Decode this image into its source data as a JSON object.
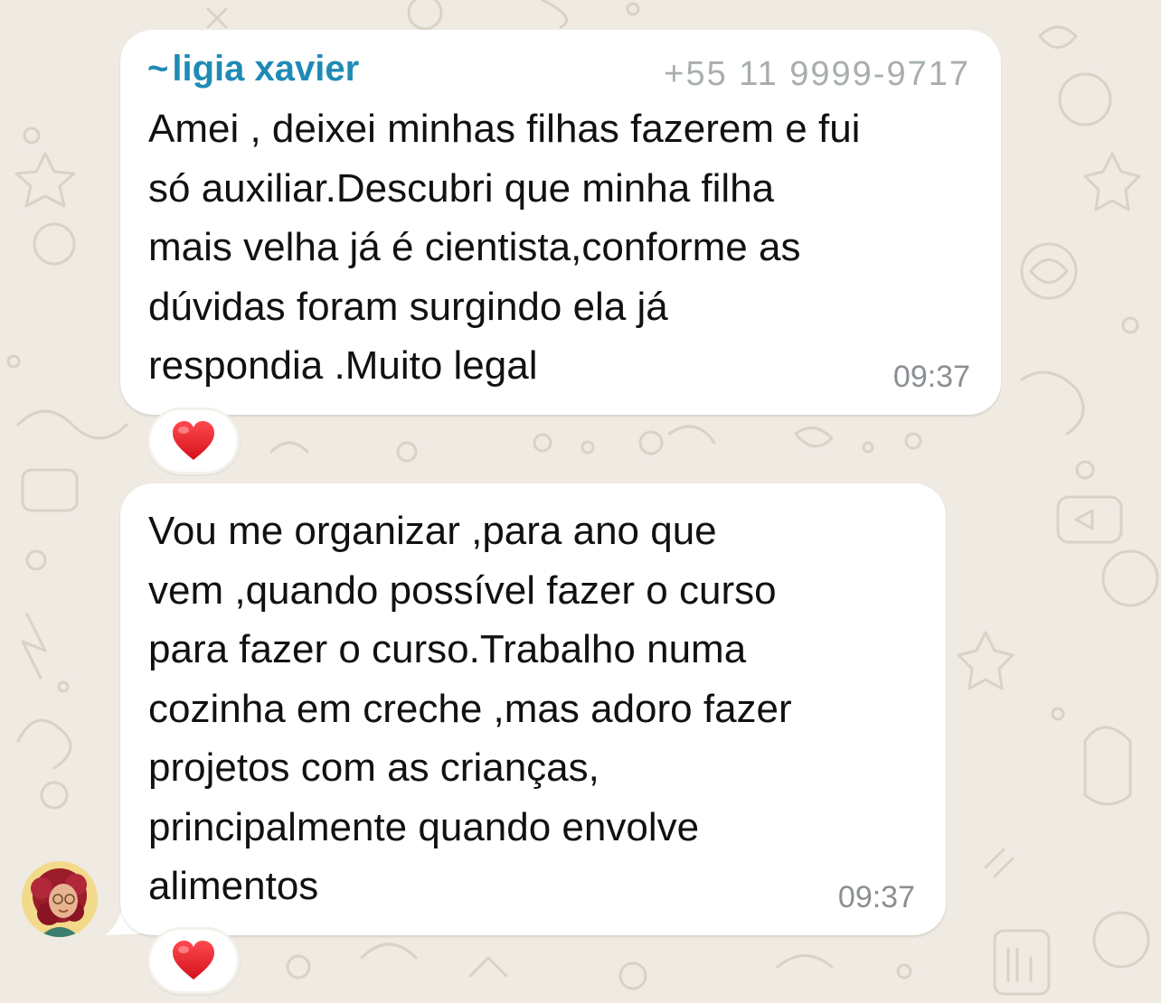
{
  "chat": {
    "messages": [
      {
        "sender": "ligia xavier",
        "sender_prefix": "~",
        "phone": "+55 11 9999-9717",
        "text": "Amei , deixei minhas filhas fazerem e fui\nsó auxiliar.Descubri que minha filha\nmais velha já é cientista,conforme as\ndúvidas foram surgindo ela já\nrespondia .Muito legal",
        "time": "09:37",
        "reaction": "❤️"
      },
      {
        "text": "Vou me organizar ,para ano que\nvem ,quando possível fazer o curso\npara fazer o curso.Trabalho numa\ncozinha em creche ,mas adoro fazer\nprojetos com as crianças,\nprincipalmente quando envolve\nalimentos",
        "time": "09:37",
        "reaction": "❤️"
      }
    ]
  },
  "colors": {
    "background": "#efeae2",
    "bubble": "#ffffff",
    "sender_name": "#1f8bb5",
    "timestamp": "#8a8f93",
    "reaction_heart": "#e0202a"
  },
  "icons": {
    "reaction": "red-heart-icon",
    "avatar": "user-avatar"
  }
}
